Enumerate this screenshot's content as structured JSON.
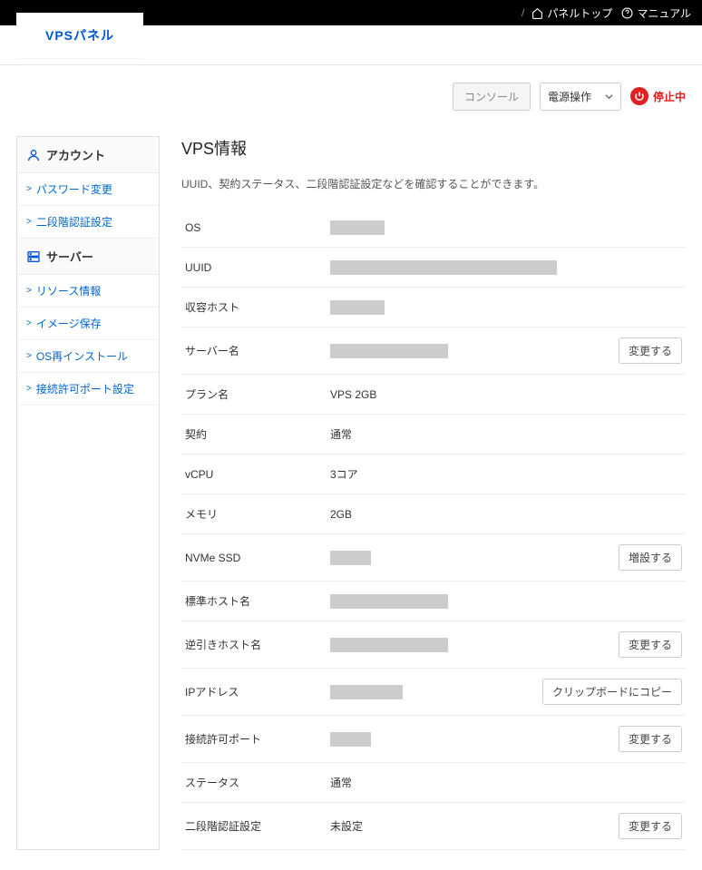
{
  "top": {
    "panel_top": "パネルトップ",
    "manual": "マニュアル",
    "slash": "/"
  },
  "logo": "VPSパネル",
  "controls": {
    "console": "コンソール",
    "power": "電源操作",
    "status": "停止中"
  },
  "sidebar": {
    "account_head": "アカウント",
    "account_items": [
      "パスワード変更",
      "二段階認証設定"
    ],
    "server_head": "サーバー",
    "server_items": [
      "リソース情報",
      "イメージ保存",
      "OS再インストール",
      "接続許可ポート設定"
    ]
  },
  "main": {
    "title": "VPS情報",
    "description": "UUID、契約ステータス、二段階認証設定などを確認することができます。",
    "buttons": {
      "change": "変更する",
      "expand": "増設する",
      "copy": "クリップボードにコピー"
    },
    "rows": [
      {
        "label": "OS",
        "value": null,
        "redact": "r60",
        "action": null
      },
      {
        "label": "UUID",
        "value": null,
        "redact": "r250",
        "action": null
      },
      {
        "label": "収容ホスト",
        "value": null,
        "redact": "r60",
        "action": null
      },
      {
        "label": "サーバー名",
        "value": null,
        "redact": "r130",
        "action": "change"
      },
      {
        "label": "プラン名",
        "value": "VPS 2GB",
        "redact": null,
        "action": null
      },
      {
        "label": "契約",
        "value": "通常",
        "redact": null,
        "action": null
      },
      {
        "label": "vCPU",
        "value": "3コア",
        "redact": null,
        "action": null
      },
      {
        "label": "メモリ",
        "value": "2GB",
        "redact": null,
        "action": null
      },
      {
        "label": "NVMe SSD",
        "value": null,
        "redact": "r45",
        "action": "expand"
      },
      {
        "label": "標準ホスト名",
        "value": null,
        "redact": "r130",
        "action": null
      },
      {
        "label": "逆引きホスト名",
        "value": null,
        "redact": "r130",
        "action": "change"
      },
      {
        "label": "IPアドレス",
        "value": null,
        "redact": "r80",
        "action": "copy"
      },
      {
        "label": "接続許可ポート",
        "value": null,
        "redact": "r45",
        "action": "change"
      },
      {
        "label": "ステータス",
        "value": "通常",
        "redact": null,
        "action": null
      },
      {
        "label": "二段階認証設定",
        "value": "未設定",
        "redact": null,
        "action": "change"
      }
    ]
  }
}
